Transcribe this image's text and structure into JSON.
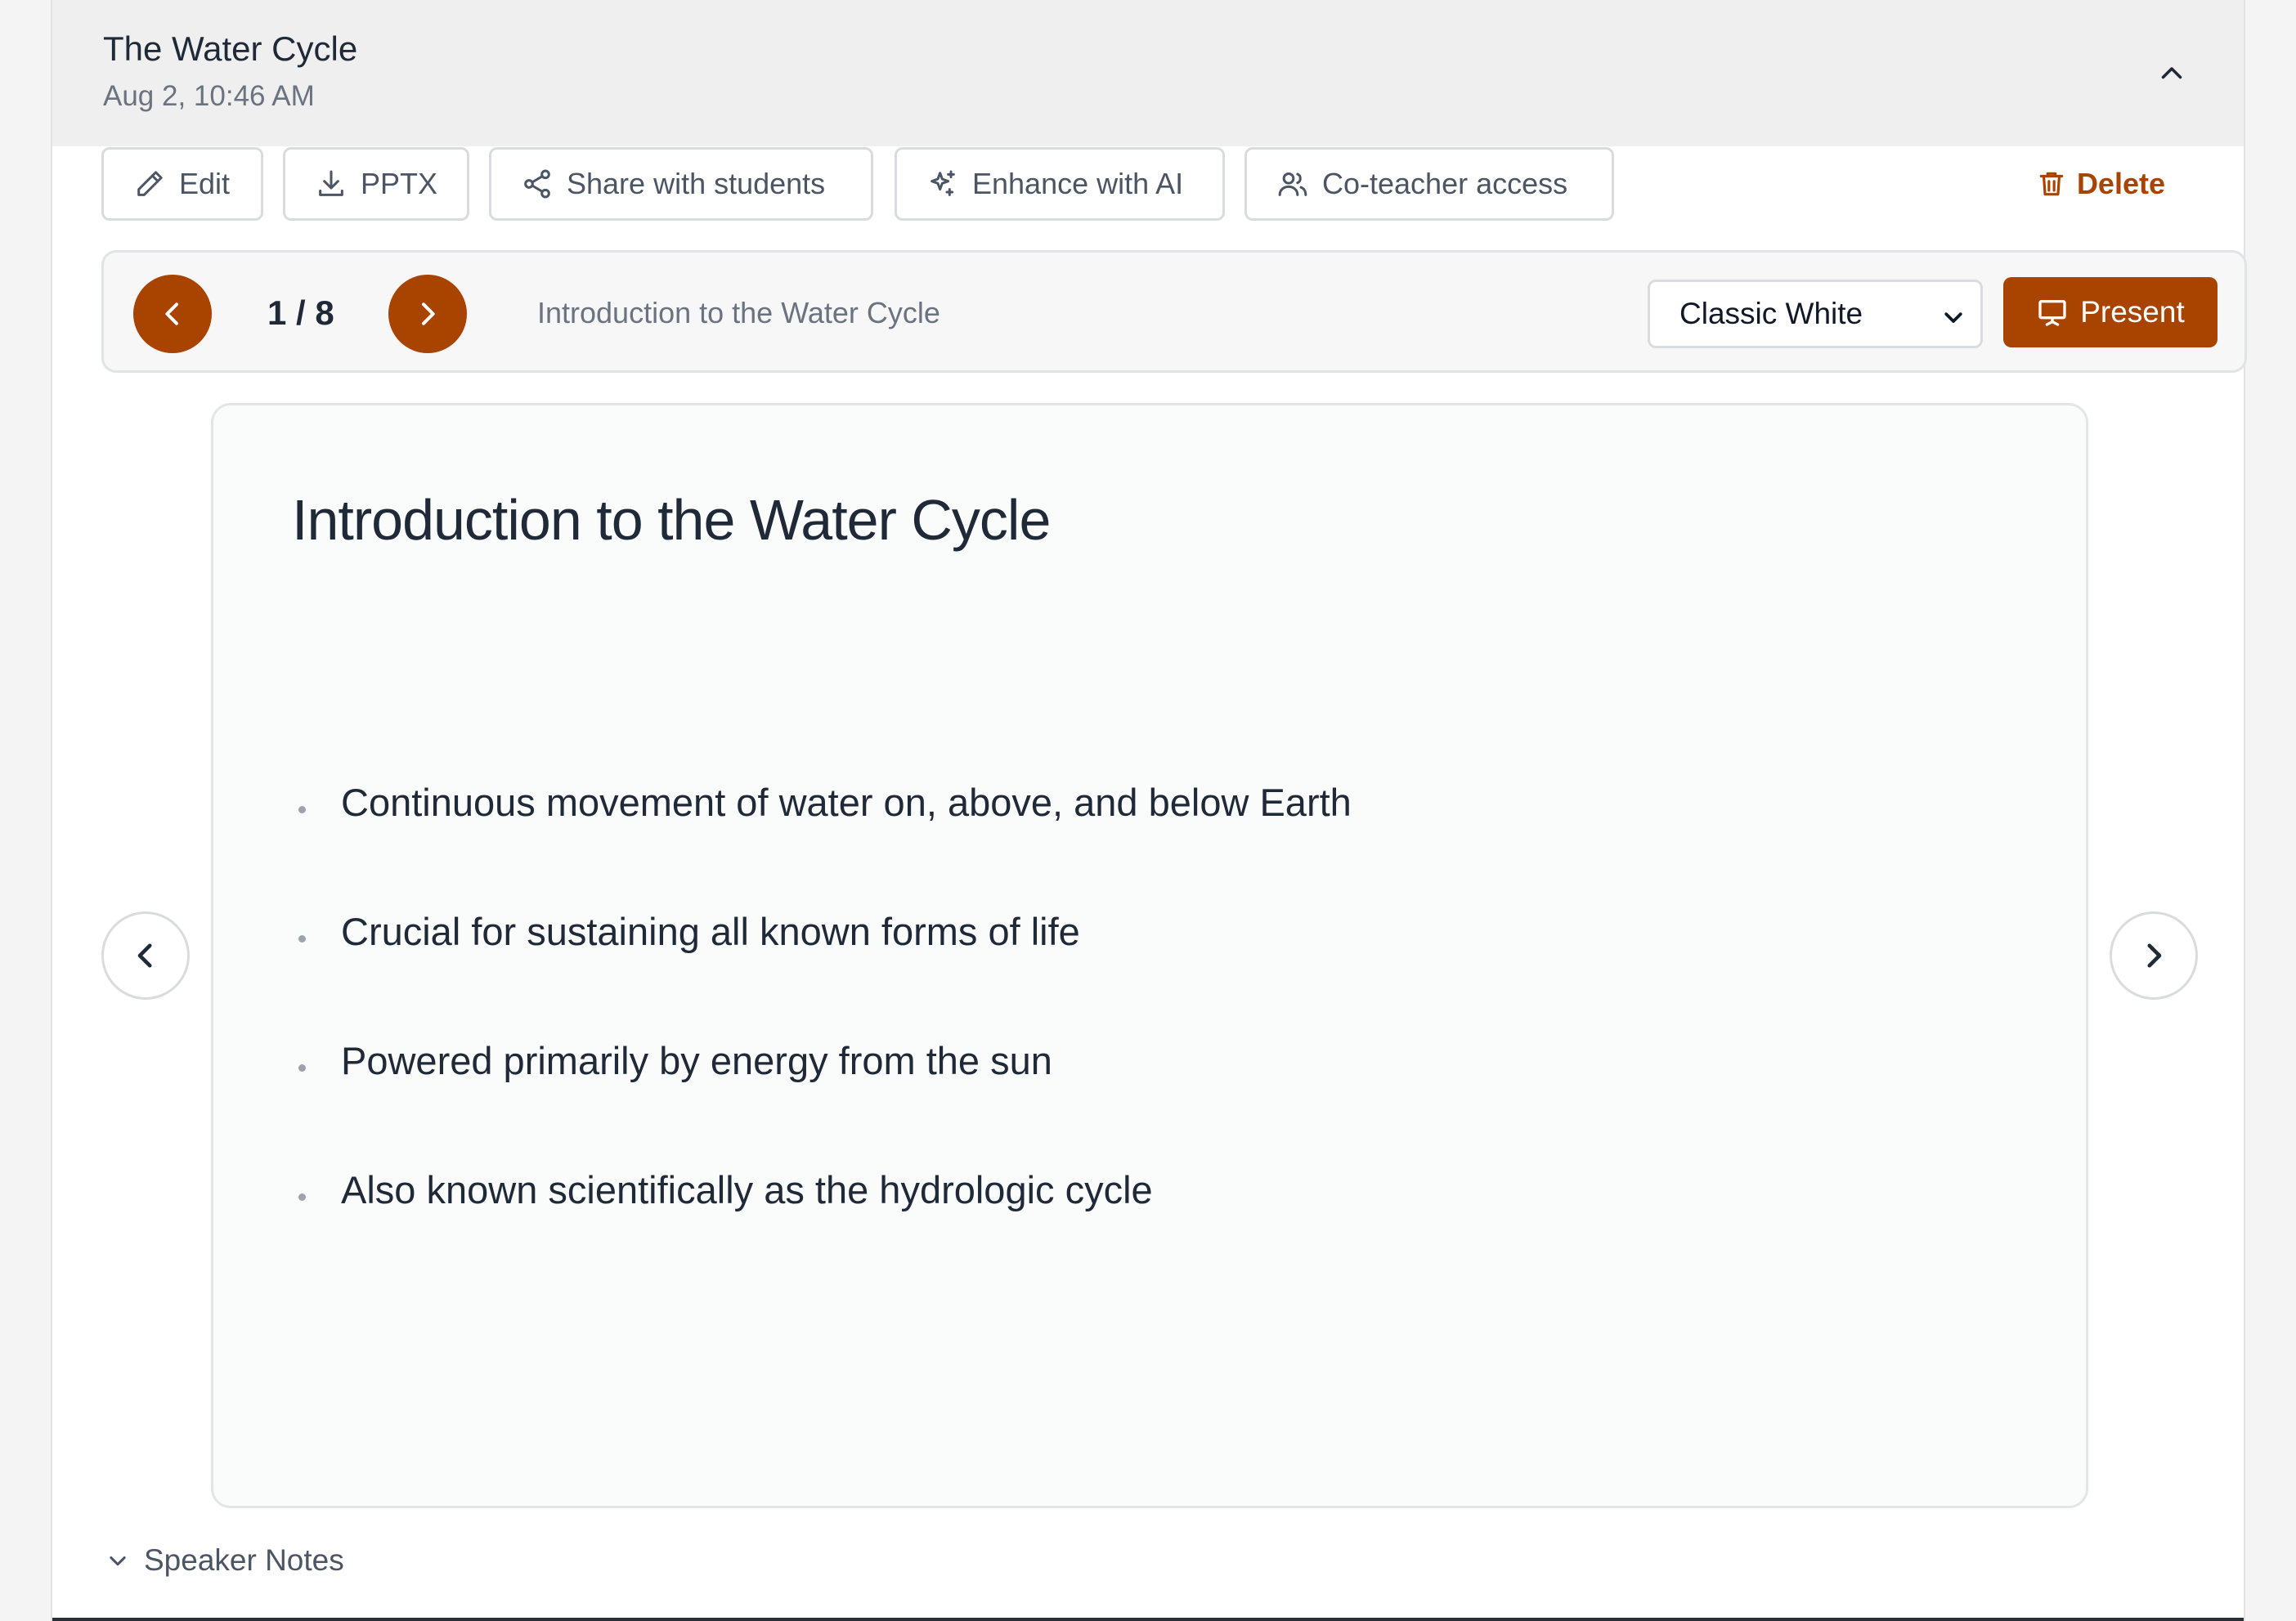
{
  "header": {
    "title": "The Water Cycle",
    "date": "Aug 2, 10:46 AM"
  },
  "toolbar": {
    "edit_label": "Edit",
    "pptx_label": "PPTX",
    "share_label": "Share with students",
    "enhance_label": "Enhance with AI",
    "coteacher_label": "Co-teacher access",
    "delete_label": "Delete"
  },
  "navigator": {
    "counter": "1 / 8",
    "current_slide_title": "Introduction to the Water Cycle",
    "theme_selected": "Classic White",
    "present_label": "Present"
  },
  "slide": {
    "heading": "Introduction to the Water Cycle",
    "bullets": [
      "Continuous movement of water on, above, and below Earth",
      "Crucial for sustaining all known forms of life",
      "Powered primarily by energy from the sun",
      "Also known scientifically as the hydrologic cycle"
    ]
  },
  "speaker_notes": {
    "label": "Speaker Notes"
  },
  "colors": {
    "accent": "#a84400",
    "header_bg": "#efefef",
    "text": "#1f2937",
    "muted": "#6b7280"
  }
}
